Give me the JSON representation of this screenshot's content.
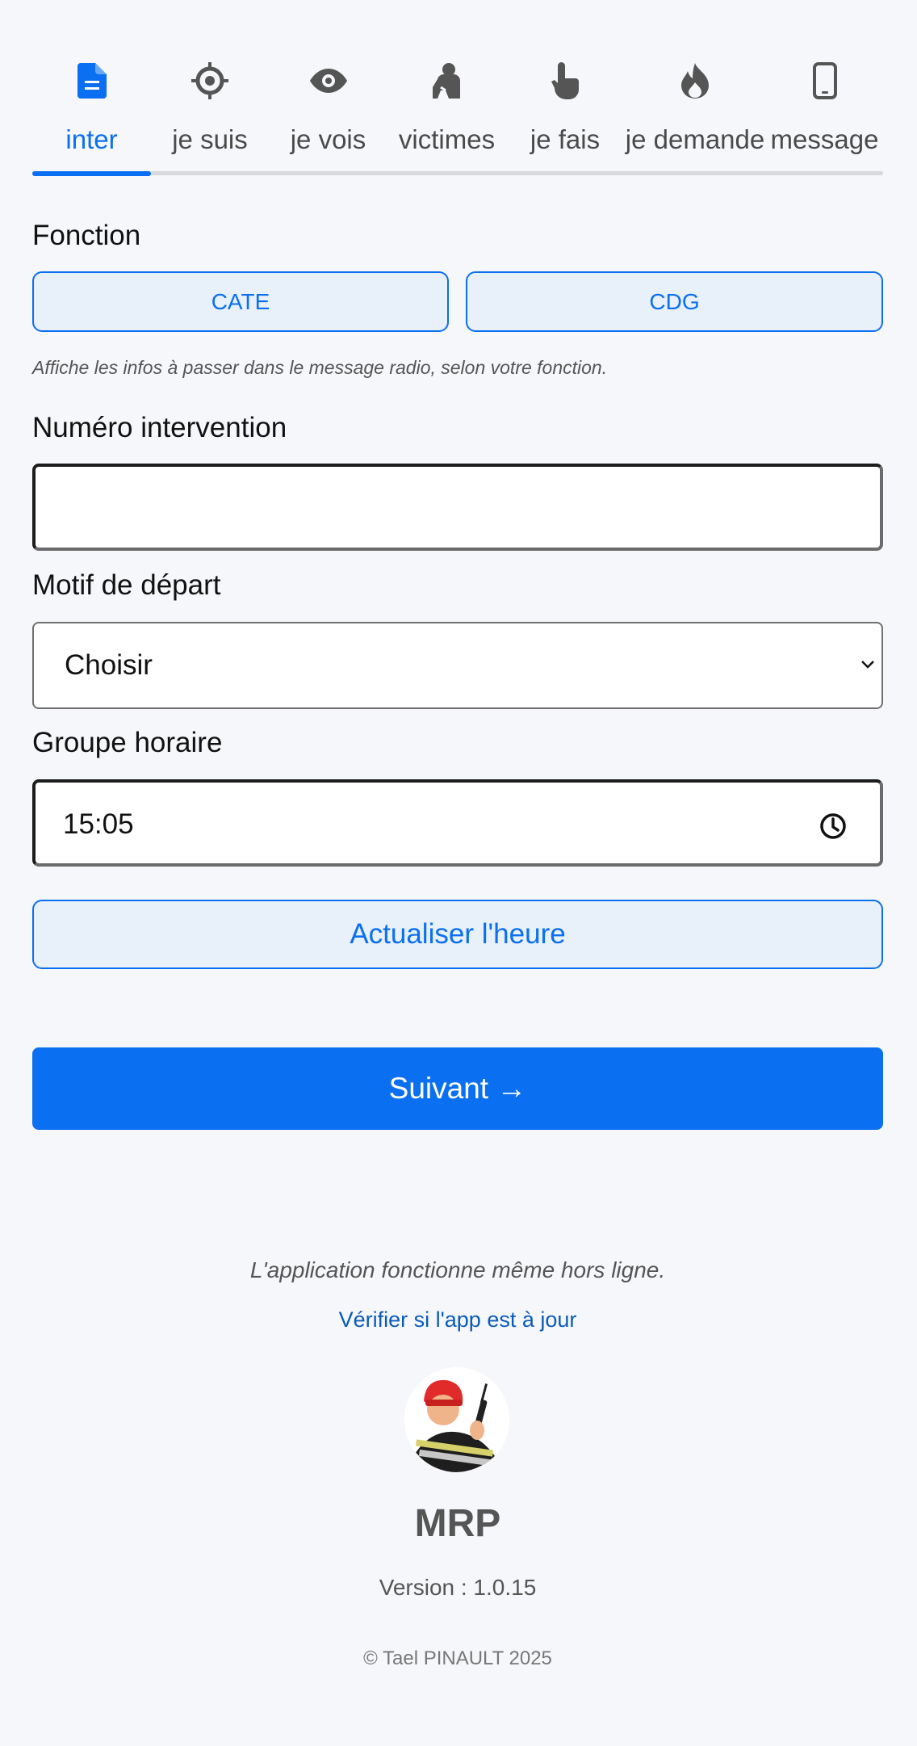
{
  "tabs": [
    {
      "label": "inter",
      "icon": "document-icon",
      "active": true
    },
    {
      "label": "je suis",
      "icon": "crosshair-icon",
      "active": false
    },
    {
      "label": "je vois",
      "icon": "eye-icon",
      "active": false
    },
    {
      "label": "victimes",
      "icon": "person-icon",
      "active": false
    },
    {
      "label": "je fais",
      "icon": "hand-pointer-icon",
      "active": false
    },
    {
      "label": "je demande",
      "icon": "fire-icon",
      "active": false
    },
    {
      "label": "message",
      "icon": "phone-icon",
      "active": false
    }
  ],
  "colors": {
    "accent": "#0a6ff0",
    "accent_bg": "#e8f0fa",
    "background": "#f5f7fa",
    "link": "#0a5bb8"
  },
  "fonction": {
    "label": "Fonction",
    "options": [
      "CATE",
      "CDG"
    ],
    "hint": "Affiche les infos à passer dans le message radio, selon votre fonction."
  },
  "numero": {
    "label": "Numéro intervention",
    "value": ""
  },
  "motif": {
    "label": "Motif de départ",
    "selected": "Choisir"
  },
  "groupe": {
    "label": "Groupe horaire",
    "value": "15:05",
    "refresh_label": "Actualiser l'heure"
  },
  "next_label": "Suivant →",
  "footer": {
    "offline": "L'application fonctionne même hors ligne.",
    "update_link": "Vérifier si l'app est à jour",
    "app_name": "MRP",
    "version": "Version : 1.0.15",
    "copyright": "© Tael PINAULT 2025"
  }
}
